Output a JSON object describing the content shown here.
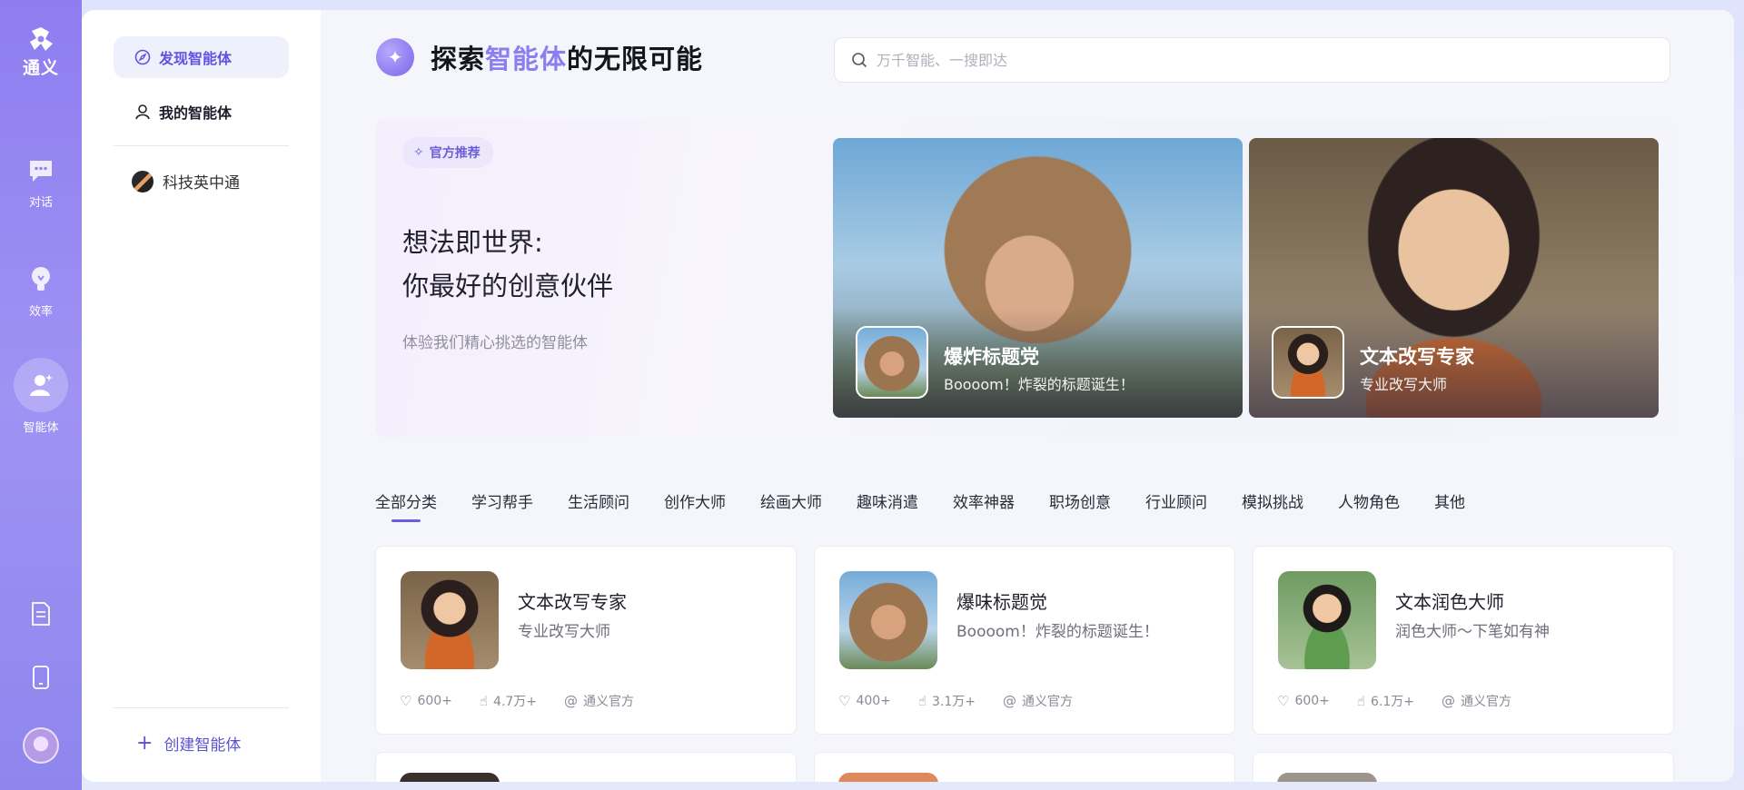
{
  "rail": {
    "brand": "通义",
    "items": [
      {
        "label": "对话",
        "icon": "chat-icon"
      },
      {
        "label": "效率",
        "icon": "bulb-icon"
      },
      {
        "label": "智能体",
        "icon": "agent-icon"
      }
    ],
    "bottom_icons": [
      "document-icon",
      "tablet-icon",
      "user-avatar"
    ]
  },
  "sidebar": {
    "items": [
      {
        "label": "发现智能体",
        "icon": "compass-icon",
        "active": true
      },
      {
        "label": "我的智能体",
        "icon": "user-icon",
        "active": false
      }
    ],
    "recent_agent": "科技英中通",
    "create_label": "创建智能体"
  },
  "header": {
    "title_prefix": "探索",
    "title_highlight": "智能体",
    "title_suffix": "的无限可能",
    "search_placeholder": "万千智能、一搜即达"
  },
  "banner": {
    "tag": "官方推荐",
    "slogan_line1": "想法即世界:",
    "slogan_line2": "你最好的创意伙伴",
    "subtitle": "体验我们精心挑选的智能体",
    "featured": [
      {
        "name": "爆炸标题党",
        "desc": "Boooom！炸裂的标题诞生！"
      },
      {
        "name": "文本改写专家",
        "desc": "专业改写大师"
      }
    ]
  },
  "tabs": [
    "全部分类",
    "学习帮手",
    "生活顾问",
    "创作大师",
    "绘画大师",
    "趣味消遣",
    "效率神器",
    "职场创意",
    "行业顾问",
    "模拟挑战",
    "人物角色",
    "其他"
  ],
  "agents": [
    {
      "name": "文本改写专家",
      "desc": "专业改写大师",
      "likes": "600+",
      "uses": "4.7万+",
      "author": "通义官方"
    },
    {
      "name": "爆味标题觉",
      "desc": "Boooom！炸裂的标题诞生！",
      "likes": "400+",
      "uses": "3.1万+",
      "author": "通义官方"
    },
    {
      "name": "文本润色大师",
      "desc": "润色大师～下笔如有神",
      "likes": "600+",
      "uses": "6.1万+",
      "author": "通义官方"
    }
  ],
  "colors": {
    "accent": "#6c5ee0",
    "rail": "#9485f1",
    "highlight": "#8b7ef0"
  }
}
